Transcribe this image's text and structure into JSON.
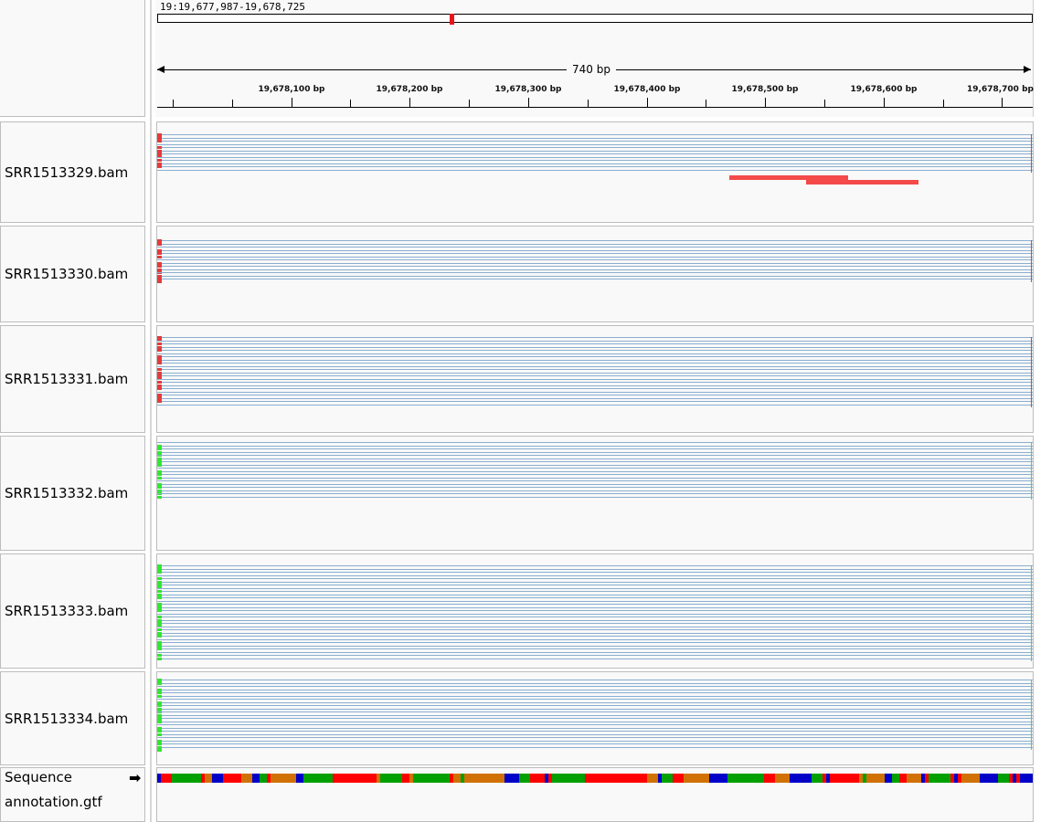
{
  "locus": "19:19,677,987-19,678,725",
  "span_label": "740 bp",
  "ruler_ticks": [
    {
      "label": "19,678,100 bp"
    },
    {
      "label": "19,678,200 bp"
    },
    {
      "label": "19,678,300 bp"
    },
    {
      "label": "19,678,400 bp"
    },
    {
      "label": "19,678,500 bp"
    },
    {
      "label": "19,678,600 bp"
    },
    {
      "label": "19,678,700 bp"
    }
  ],
  "tracks": [
    {
      "name": "SRR1513329.bam",
      "clip_color": "#e43b3b",
      "reads": 12
    },
    {
      "name": "SRR1513330.bam",
      "clip_color": "#e43b3b",
      "reads": 13
    },
    {
      "name": "SRR1513331.bam",
      "clip_color": "#e43b3b",
      "reads": 22
    },
    {
      "name": "SRR1513332.bam",
      "clip_color": "#33e633",
      "reads": 18
    },
    {
      "name": "SRR1513333.bam",
      "clip_color": "#33e633",
      "reads": 30
    },
    {
      "name": "SRR1513334.bam",
      "clip_color": "#33e633",
      "reads": 22
    }
  ],
  "sequence_label": "Sequence",
  "sequence_arrow": "➡",
  "annotation_label": "annotation.gtf",
  "colors": {
    "read": "#8aaed0",
    "mismatch_bar": "#f44a4a",
    "ideogram_marker": "#e8151b",
    "base_A": "#00a000",
    "base_C": "#0000c8",
    "base_G": "#d17105",
    "base_T": "#ff0000"
  }
}
